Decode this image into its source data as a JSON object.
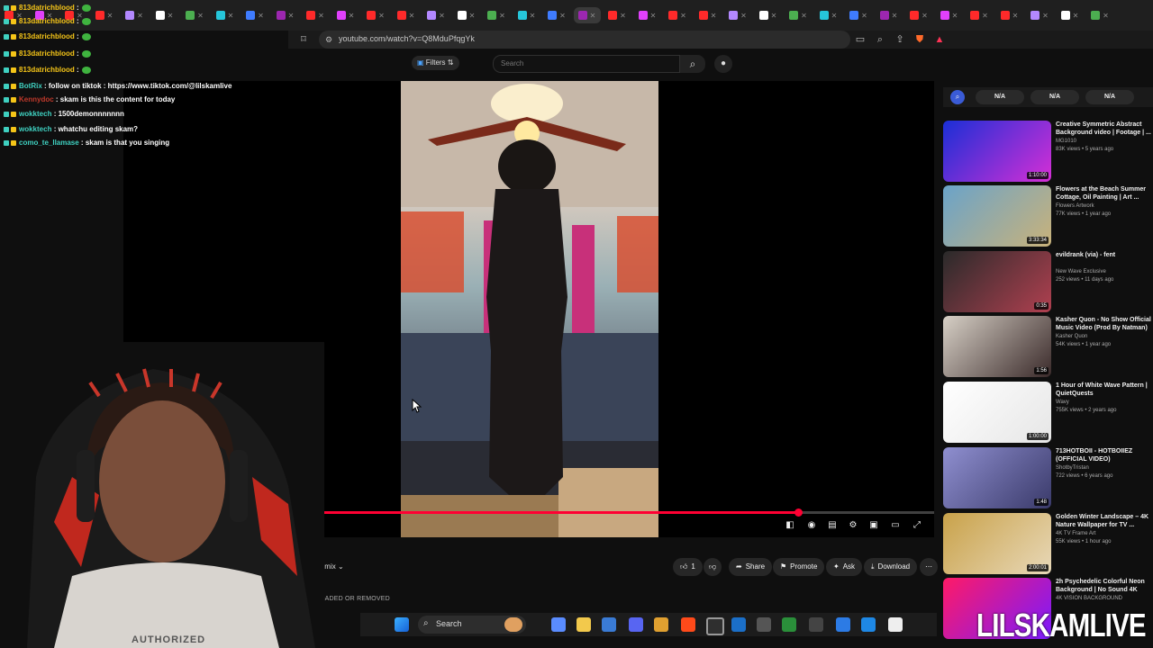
{
  "browser": {
    "tabs_count": 37,
    "url": "youtube.com/watch?v=Q8MduPfqgYk"
  },
  "youtube": {
    "filters_label": "Filters",
    "search_placeholder": "Search",
    "progress_fraction": 0.78,
    "actions": {
      "remix": "Remix",
      "like_count": "1",
      "share": "Share",
      "promote": "Promote",
      "ask": "Ask",
      "download": "Download"
    },
    "status_line": "OADED OR REMOVED",
    "chips": [
      "N/A",
      "N/A",
      "N/A"
    ],
    "recommendations": [
      {
        "title": "Creative Symmetric Abstract Background video | Footage | ...",
        "channel": "MG1010",
        "meta": "83K views • 5 years ago",
        "duration": "1:10:00",
        "colors": [
          "#1a2fd6",
          "#d62fd6"
        ]
      },
      {
        "title": "Flowers at the Beach Summer Cottage, Oil Painting | Art ...",
        "channel": "Flowers Artwork",
        "meta": "77K views • 1 year ago",
        "duration": "3:33:34",
        "colors": [
          "#6aa3c9",
          "#c9b27a"
        ]
      },
      {
        "title": "evildrank (via) - fent",
        "channel": "New Wave Exclusive",
        "meta": "252 views • 11 days ago",
        "duration": "0:35",
        "colors": [
          "#2a2a2a",
          "#b04050"
        ]
      },
      {
        "title": "Kasher Quon - No Show Official Music Video (Prod By Natman)",
        "channel": "Kasher Quon",
        "meta": "54K views • 1 year ago",
        "duration": "1:56",
        "colors": [
          "#d7d0c6",
          "#3a2a2a"
        ]
      },
      {
        "title": "1 Hour of White Wave Pattern | QuietQuests",
        "channel": "Wavy",
        "meta": "755K views • 2 years ago",
        "duration": "1:00:00",
        "colors": [
          "#ffffff",
          "#e6e6e6"
        ]
      },
      {
        "title": "713HOTBOII - HOTBOIIEZ (OFFICIAL VIDEO)",
        "channel": "ShotbyTristan",
        "meta": "722 views • 6 years ago",
        "duration": "1:48",
        "colors": [
          "#8f8fd0",
          "#3a3a6a"
        ]
      },
      {
        "title": "Golden Winter Landscape – 4K Nature Wallpaper for TV ...",
        "channel": "4K TV Frame Art",
        "meta": "55K views • 1 hour ago",
        "duration": "2:00:01",
        "colors": [
          "#c9a24a",
          "#e8d8b8"
        ]
      },
      {
        "title": "2h Psychedelic Colorful Neon Background | No Sound 4K",
        "channel": "4K VISION BACKGROUND",
        "meta": "",
        "duration": "",
        "colors": [
          "#ff1a66",
          "#7a1aff"
        ]
      }
    ]
  },
  "chat": [
    {
      "user": "813datrichblood",
      "sep": " :",
      "msg": "",
      "color": "#f5c518"
    },
    {
      "user": "813datrichblood",
      "sep": " :",
      "msg": "",
      "color": "#f5c518"
    },
    {
      "user": "813datrichblood",
      "sep": " :",
      "msg": "",
      "color": "#f5c518"
    },
    {
      "user": "813datrichblood",
      "sep": " :",
      "msg": "",
      "color": "#f5c518"
    },
    {
      "user": "813datrichblood",
      "sep": " :",
      "msg": "",
      "color": "#f5c518"
    },
    {
      "user": "BotRix",
      "sep": " : ",
      "msg": "follow on tiktok : https://www.tiktok.com/@lilskamlive",
      "color": "#3fd0c0"
    },
    {
      "user": "Kennydoc",
      "sep": " : ",
      "msg": "skam is this the content for today",
      "color": "#c0392b"
    },
    {
      "user": "wokktech",
      "sep": " : ",
      "msg": "1500demonnnnnnn",
      "color": "#3fd0c0"
    },
    {
      "user": "wokktech",
      "sep": " : ",
      "msg": "whatchu editing skam?",
      "color": "#3fd0c0"
    },
    {
      "user": "como_te_llamase",
      "sep": " : ",
      "msg": "skam is that you singing",
      "color": "#3fd0c0"
    }
  ],
  "taskbar": {
    "search_label": "Search"
  },
  "webcam": {
    "shirt_text": "AUTHORIZED"
  },
  "watermark": "LILSKAMLIVE",
  "colors": {
    "youtube_red": "#ff0033",
    "bg": "#0f0f0f"
  }
}
